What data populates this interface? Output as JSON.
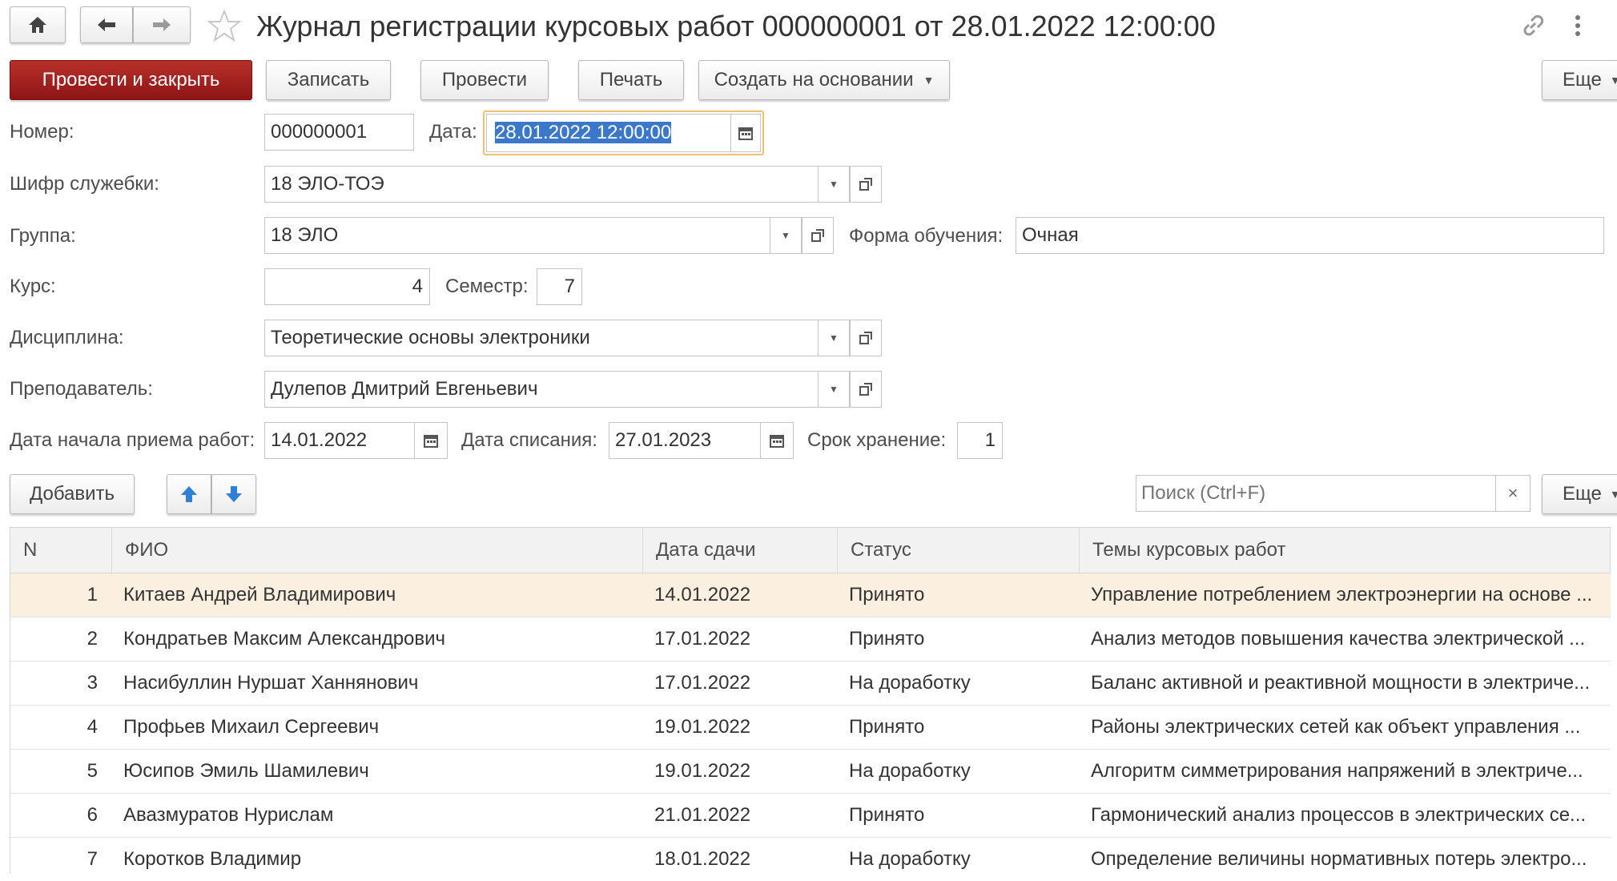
{
  "header": {
    "title": "Журнал регистрации курсовых работ 000000001 от 28.01.2022 12:00:00"
  },
  "toolbar": {
    "post_close": "Провести и закрыть",
    "save": "Записать",
    "post": "Провести",
    "print": "Печать",
    "create_based": "Создать на основании",
    "more": "Еще"
  },
  "form": {
    "number_label": "Номер:",
    "number_value": "000000001",
    "date_label": "Дата:",
    "date_value": "28.01.2022 12:00:00",
    "cipher_label": "Шифр служебки:",
    "cipher_value": "18 ЭЛО-ТОЭ",
    "group_label": "Группа:",
    "group_value": "18 ЭЛО",
    "study_form_label": "Форма обучения:",
    "study_form_value": "Очная",
    "course_label": "Курс:",
    "course_value": "4",
    "semester_label": "Семестр:",
    "semester_value": "7",
    "discipline_label": "Дисциплина:",
    "discipline_value": "Теоретические основы электроники",
    "teacher_label": "Преподаватель:",
    "teacher_value": "Дулепов Дмитрий Евгеньевич",
    "start_date_label": "Дата начала приема работ:",
    "start_date_value": "14.01.2022",
    "writeoff_label": "Дата списания:",
    "writeoff_value": "27.01.2023",
    "storage_label": "Срок хранение:",
    "storage_value": "1"
  },
  "table_toolbar": {
    "add": "Добавить",
    "search_placeholder": "Поиск (Ctrl+F)",
    "more": "Еще"
  },
  "table": {
    "columns": [
      "N",
      "ФИО",
      "Дата сдачи",
      "Статус",
      "Темы курсовых работ"
    ],
    "rows": [
      {
        "n": "1",
        "fio": "Китаев Андрей Владимирович",
        "date": "14.01.2022",
        "status": "Принято",
        "topic": "Управление потреблением электроэнергии на основе ..."
      },
      {
        "n": "2",
        "fio": "Кондратьев Максим Александрович",
        "date": "17.01.2022",
        "status": "Принято",
        "topic": "Анализ методов повышения качества электрической ..."
      },
      {
        "n": "3",
        "fio": "Насибуллин Нуршат Ханнянович",
        "date": "17.01.2022",
        "status": "На доработку",
        "topic": "Баланс активной и реактивной мощности в электриче..."
      },
      {
        "n": "4",
        "fio": "Профьев Михаил Сергеевич",
        "date": "19.01.2022",
        "status": "Принято",
        "topic": "Районы электрических сетей как объект управления ..."
      },
      {
        "n": "5",
        "fio": "Юсипов Эмиль Шамилевич",
        "date": "19.01.2022",
        "status": "На доработку",
        "topic": "Алгоритм симметрирования напряжений в электриче..."
      },
      {
        "n": "6",
        "fio": "Авазмуратов Нурислам",
        "date": "21.01.2022",
        "status": "Принято",
        "topic": "Гармонический анализ процессов в электрических се..."
      },
      {
        "n": "7",
        "fio": "Коротков Владимир",
        "date": "18.01.2022",
        "status": "На доработку",
        "topic": "Определение величины нормативных потерь электро..."
      }
    ]
  },
  "colors": {
    "primary_button": "#9b1c1c",
    "selected_row": "#fbf0df",
    "date_focus": "#f0c070",
    "date_selection": "#3b78c9",
    "arrow_blue": "#2f7fd6"
  },
  "icons": [
    "home-icon",
    "back-icon",
    "forward-icon",
    "star-icon",
    "link-icon",
    "more-vert-icon",
    "calendar-icon",
    "dropdown-icon",
    "open-icon",
    "arrow-up-icon",
    "arrow-down-icon",
    "clear-icon"
  ]
}
